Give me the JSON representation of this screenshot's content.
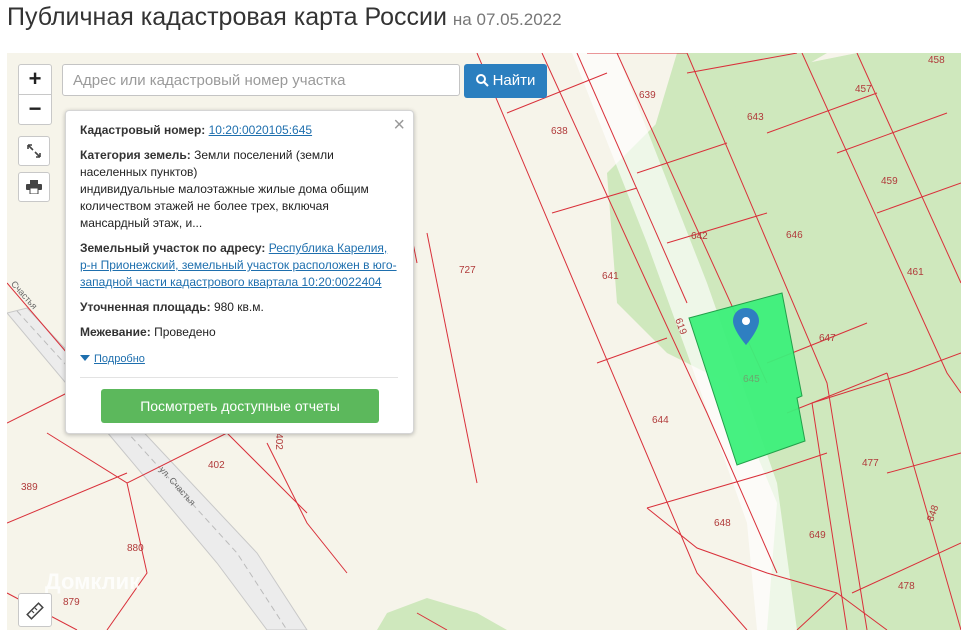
{
  "header": {
    "title": "Публичная кадастровая карта России",
    "date": "на 07.05.2022"
  },
  "search": {
    "placeholder": "Адрес или кадастровый номер участка",
    "button_label": "Найти"
  },
  "zoom": {
    "in": "+",
    "out": "−"
  },
  "controls": {
    "fullscreen_icon": "expand-icon",
    "print_icon": "print-icon",
    "ruler_icon": "ruler-icon"
  },
  "popup": {
    "cadastral_label": "Кадастровый номер:",
    "cadastral_value": "10:20:0020105:645",
    "category_label": "Категория земель:",
    "category_value": "Земли поселений (земли населенных пунктов)",
    "usage_value": "индивидуальные малоэтажные жилые дома общим количеством этажей не более трех, включая мансардный этаж, и...",
    "address_label": "Земельный участок по адресу:",
    "address_value": "Республика Карелия, р-н Прионежский, земельный участок расположен в юго-западной части кадастрового квартала 10:20:0022404",
    "area_label": "Уточненная площадь:",
    "area_value": "980 кв.м.",
    "survey_label": "Межевание:",
    "survey_value": "Проведено",
    "more_link": "Подробно",
    "reports_button": "Посмотреть доступные отчеты"
  },
  "map": {
    "parcel_labels": [
      "458",
      "457",
      "639",
      "643",
      "638",
      "459",
      "642",
      "646",
      "461",
      "727",
      "641",
      "619",
      "647",
      "645",
      "644",
      "477",
      "402",
      "389",
      "880",
      "648",
      "649",
      "848",
      "879",
      "478"
    ],
    "street_labels": [
      "ул. Счастья",
      "Счастья"
    ],
    "watermark": "Домклик",
    "colors": {
      "forest": "#cfe8bd",
      "ground": "#f6f4ea",
      "boundary": "#d9303a",
      "selected": "#3cf07a",
      "marker": "#2f7fc1"
    }
  }
}
